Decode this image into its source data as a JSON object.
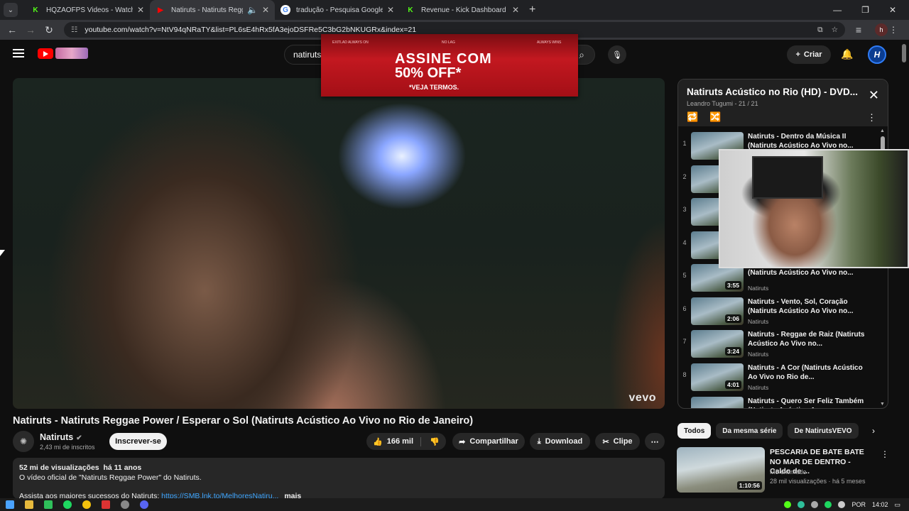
{
  "browser": {
    "tabs": [
      {
        "title": "HQZAOFPS Videos - Watch On",
        "fav": "K",
        "fav_color": "#53fc18"
      },
      {
        "title": "Natiruts - Natiruts Reggae",
        "fav": "▶",
        "fav_color": "#ff0000"
      },
      {
        "title": "tradução - Pesquisa Google",
        "fav": "G",
        "fav_color": "#ffffff"
      },
      {
        "title": "Revenue - Kick Dashboard",
        "fav": "K",
        "fav_color": "#53fc18"
      }
    ],
    "url": "youtube.com/watch?v=NtV94qNRaTY&list=PL6sE4hRx5fA3ejoDSFRe5C3bG2bNKUGRx&index=21",
    "profile": "h"
  },
  "header": {
    "search_value": "natiruts",
    "create_label": "Criar",
    "avatar_letter": "H"
  },
  "ad": {
    "line1": "ASSINE COM",
    "line2": "50% OFF*",
    "line3": "*VEJA TERMOS.",
    "tag1": "EXITLAD ALWAYS ON",
    "tag2": "NO LAG",
    "tag3": "ALWAYS WINS"
  },
  "video": {
    "watermark": "vevo",
    "title": "Natiruts - Natiruts Reggae Power / Esperar o Sol (Natiruts Acústico Ao Vivo no Rio de Janeiro)",
    "channel": "Natiruts",
    "subscribers": "2,43 mi de inscritos",
    "subscribe_label": "Inscrever-se",
    "likes": "166 mil",
    "share_label": "Compartilhar",
    "download_label": "Download",
    "clip_label": "Clipe"
  },
  "description": {
    "views": "52 mi de visualizações",
    "age": "há 11 anos",
    "line1": "O vídeo oficial de \"Natiruts Reggae Power\" do Natiruts.",
    "line2_prefix": "Assista aos maiores sucessos do Natiruts: ",
    "line2_link": "https://SMB.lnk.to/MelhoresNatiru...",
    "more": "mais"
  },
  "playlist": {
    "title": "Natiruts Acústico no Rio (HD) - DVD...",
    "owner": "Leandro Tugumi",
    "position": "21 / 21",
    "items": [
      {
        "index": "1",
        "title": "Natiruts - Dentro da Música II (Natiruts Acústico Ao Vivo no...",
        "channel": "",
        "duration": ""
      },
      {
        "index": "2",
        "title": "",
        "channel": "",
        "duration": ""
      },
      {
        "index": "3",
        "title": "",
        "channel": "",
        "duration": ""
      },
      {
        "index": "4",
        "title": "",
        "channel": "",
        "duration": ""
      },
      {
        "index": "5",
        "title": "(Natiruts Acústico Ao Vivo no...",
        "channel": "Natiruts",
        "duration": "3:55"
      },
      {
        "index": "6",
        "title": "Natiruts - Vento, Sol, Coração (Natiruts Acústico Ao Vivo no...",
        "channel": "Natiruts",
        "duration": "2:06"
      },
      {
        "index": "7",
        "title": "Natiruts - Reggae de Raiz (Natiruts Acústico Ao Vivo no...",
        "channel": "Natiruts",
        "duration": "3:24"
      },
      {
        "index": "8",
        "title": "Natiruts - A Cor (Natiruts Acústico Ao Vivo no Rio de...",
        "channel": "Natiruts",
        "duration": "4:01"
      },
      {
        "index": "",
        "title": "Natiruts - Quero Ser Feliz Também (Natiruts Acústico A...",
        "channel": "",
        "duration": ""
      }
    ]
  },
  "chips": [
    "Todos",
    "Da mesma série",
    "De NatirutsVEVO"
  ],
  "recommendation": {
    "title": "PESCARIA DE BATE BATE NO MAR DE DENTRO - Caldo de ...",
    "channel": "Mó extimado",
    "meta": "28 mil visualizações · há 5 meses",
    "duration": "1:10:56"
  },
  "taskbar": {
    "lang": "POR",
    "time": "14:02"
  }
}
